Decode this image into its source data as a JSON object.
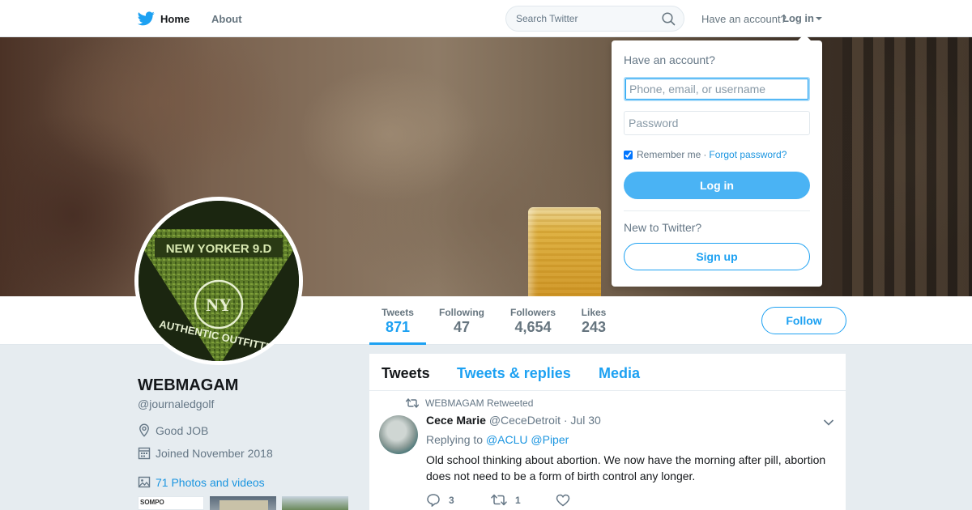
{
  "nav": {
    "home_label": "Home",
    "about_label": "About",
    "search_placeholder": "Search Twitter",
    "have_account": "Have an account?",
    "login_label": "Log in"
  },
  "profile": {
    "name": "WEBMAGAM",
    "handle": "@journaledgolf",
    "location": "Good JOB",
    "joined": "Joined November 2018",
    "photos_link": "71 Photos and videos",
    "avatar_text_top": "NEW YORKER 9.D",
    "avatar_monogram": "NY",
    "avatar_text_bottom": "AUTHENTIC OUTFITTER"
  },
  "stats": [
    {
      "label": "Tweets",
      "value": "871",
      "active": true
    },
    {
      "label": "Following",
      "value": "47",
      "active": false
    },
    {
      "label": "Followers",
      "value": "4,654",
      "active": false
    },
    {
      "label": "Likes",
      "value": "243",
      "active": false
    }
  ],
  "follow_label": "Follow",
  "timeline": {
    "tabs": [
      {
        "label": "Tweets",
        "active": true
      },
      {
        "label": "Tweets & replies",
        "active": false
      },
      {
        "label": "Media",
        "active": false
      }
    ],
    "tweet": {
      "retweeted_by": "WEBMAGAM Retweeted",
      "author_name": "Cece Marie",
      "author_handle": "@CeceDetroit",
      "separator": "·",
      "date": "Jul 30",
      "replying_to_label": "Replying to",
      "mentions": [
        "@ACLU",
        "@Piper"
      ],
      "text": "Old school thinking about abortion. We now have the morning after pill, abortion does not need to be a form of birth control any longer.",
      "reply_count": "3",
      "retweet_count": "1",
      "like_count": ""
    }
  },
  "thumbs": [
    "SOMPO",
    "",
    ""
  ],
  "login_dropdown": {
    "title": "Have an account?",
    "username_placeholder": "Phone, email, or username",
    "password_placeholder": "Password",
    "remember_label": "Remember me",
    "separator": "·",
    "forgot_label": "Forgot password?",
    "login_button": "Log in",
    "new_label": "New to Twitter?",
    "signup_button": "Sign up"
  },
  "colors": {
    "accent": "#1da1f2",
    "link": "#1b95e0",
    "login_button": "#4ab3f4",
    "background": "#e6ecf0"
  }
}
